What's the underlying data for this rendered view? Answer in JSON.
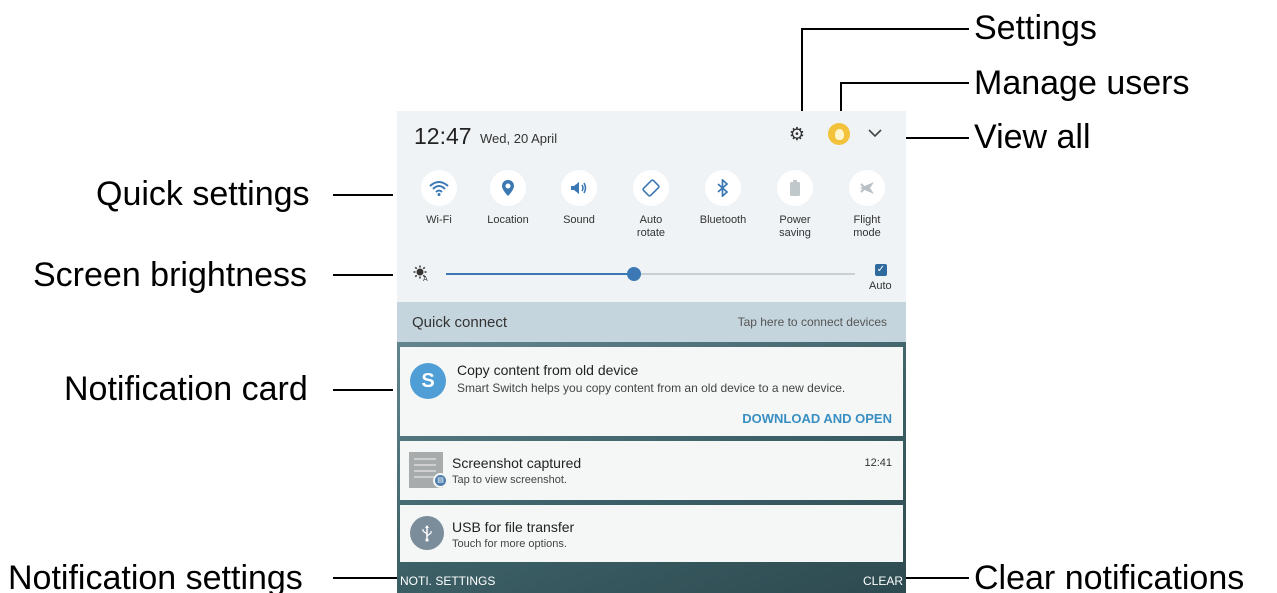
{
  "callouts": {
    "settings": "Settings",
    "manage_users": "Manage users",
    "view_all": "View all",
    "quick_settings": "Quick settings",
    "screen_brightness": "Screen brightness",
    "notification_card": "Notification card",
    "notification_settings": "Notification settings",
    "clear_notifications": "Clear notifications"
  },
  "status": {
    "time": "12:47",
    "date": "Wed, 20 April",
    "icons": [
      "gear-icon",
      "user-avatar-icon",
      "chevron-down-icon"
    ]
  },
  "quick_settings": [
    {
      "label": "Wi-Fi",
      "icon": "wifi-icon",
      "on": true
    },
    {
      "label": "Location",
      "icon": "location-pin-icon",
      "on": true
    },
    {
      "label": "Sound",
      "icon": "speaker-icon",
      "on": true
    },
    {
      "label": "Auto rotate",
      "icon": "rotate-icon",
      "on": true
    },
    {
      "label": "Bluetooth",
      "icon": "bluetooth-icon",
      "on": true
    },
    {
      "label": "Power saving",
      "icon": "battery-icon",
      "on": false
    },
    {
      "label": "Flight mode",
      "icon": "airplane-icon",
      "on": false
    }
  ],
  "brightness": {
    "level": 0.46,
    "auto_label": "Auto",
    "auto_checked": true
  },
  "quick_connect": {
    "title": "Quick connect",
    "hint": "Tap here to connect devices"
  },
  "notifications": [
    {
      "title": "Copy content from old device",
      "subtitle": "Smart Switch helps you copy content from an old device to a new device.",
      "action": "DOWNLOAD AND OPEN",
      "icon_letter": "S"
    },
    {
      "title": "Screenshot captured",
      "subtitle": "Tap to view screenshot.",
      "time": "12:41"
    },
    {
      "title": "USB for file transfer",
      "subtitle": "Touch for more options."
    }
  ],
  "footer": {
    "left": "NOTI. SETTINGS",
    "right": "CLEAR"
  },
  "colors": {
    "accent": "#3c78b4",
    "action": "#3a8fc2",
    "panel_bg": "#eff3f5",
    "quick_connect_bg": "#c5d5dd"
  }
}
